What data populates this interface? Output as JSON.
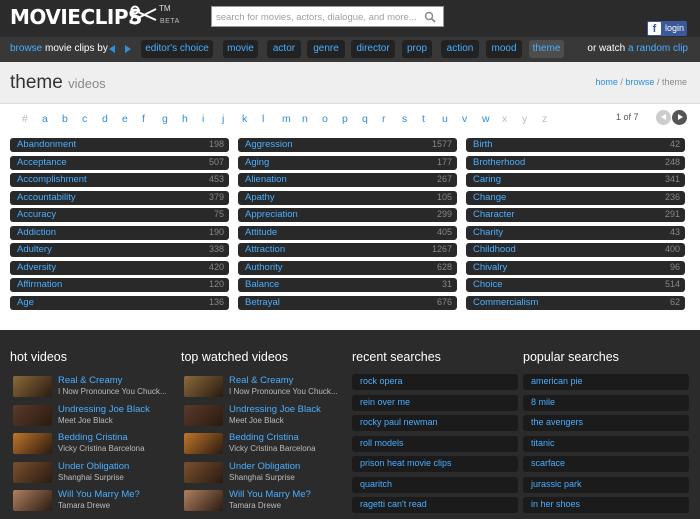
{
  "header": {
    "logo": "MOVIECLIPS",
    "tm": "TM",
    "beta": "BETA",
    "search_placeholder": "search for movies, actors, dialogue, and more...",
    "fb_glyph": "f",
    "login": "login"
  },
  "nav": {
    "browse": "browse",
    "movie_clips_by": "movie clips by",
    "tabs": [
      "editor's choice",
      "movie",
      "actor",
      "genre",
      "director",
      "prop",
      "action",
      "mood",
      "theme"
    ],
    "active_tab": "theme",
    "or_watch": "or watch",
    "random_clip": "a random clip"
  },
  "page": {
    "title": "theme",
    "title_suffix": "videos",
    "crumbs": [
      "home",
      "browse",
      "theme"
    ],
    "crumb_sep": "/"
  },
  "alphabet": [
    "#",
    "a",
    "b",
    "c",
    "d",
    "e",
    "f",
    "g",
    "h",
    "i",
    "j",
    "k",
    "l",
    "m",
    "n",
    "o",
    "p",
    "q",
    "r",
    "s",
    "t",
    "u",
    "v",
    "w",
    "x",
    "y",
    "z"
  ],
  "alphabet_disabled": [
    "#",
    "x",
    "y",
    "z"
  ],
  "pager": {
    "text": "1 of 7"
  },
  "themes": [
    [
      {
        "name": "Abandonment",
        "count": "198"
      },
      {
        "name": "Acceptance",
        "count": "507"
      },
      {
        "name": "Accomplishment",
        "count": "453"
      },
      {
        "name": "Accountability",
        "count": "379"
      },
      {
        "name": "Accuracy",
        "count": "75"
      },
      {
        "name": "Addiction",
        "count": "190"
      },
      {
        "name": "Adultery",
        "count": "338"
      },
      {
        "name": "Adversity",
        "count": "420"
      },
      {
        "name": "Affirmation",
        "count": "120"
      },
      {
        "name": "Age",
        "count": "136"
      }
    ],
    [
      {
        "name": "Aggression",
        "count": "1577"
      },
      {
        "name": "Aging",
        "count": "177"
      },
      {
        "name": "Alienation",
        "count": "267"
      },
      {
        "name": "Apathy",
        "count": "105"
      },
      {
        "name": "Appreciation",
        "count": "299"
      },
      {
        "name": "Attitude",
        "count": "405"
      },
      {
        "name": "Attraction",
        "count": "1267"
      },
      {
        "name": "Authority",
        "count": "628"
      },
      {
        "name": "Balance",
        "count": "31"
      },
      {
        "name": "Betrayal",
        "count": "676"
      }
    ],
    [
      {
        "name": "Birth",
        "count": "42"
      },
      {
        "name": "Brotherhood",
        "count": "248"
      },
      {
        "name": "Caring",
        "count": "341"
      },
      {
        "name": "Change",
        "count": "236"
      },
      {
        "name": "Character",
        "count": "291"
      },
      {
        "name": "Charity",
        "count": "43"
      },
      {
        "name": "Childhood",
        "count": "400"
      },
      {
        "name": "Chivalry",
        "count": "96"
      },
      {
        "name": "Choice",
        "count": "514"
      },
      {
        "name": "Commercialism",
        "count": "62"
      }
    ]
  ],
  "hot_videos": {
    "heading": "hot videos",
    "items": [
      {
        "title": "Real & Creamy",
        "sub": "I Now Pronounce You Chuck...",
        "thumb": "#8a6a3a"
      },
      {
        "title": "Undressing Joe Black",
        "sub": "Meet Joe Black",
        "thumb": "#5a3a2a"
      },
      {
        "title": "Bedding Cristina",
        "sub": "Vicky Cristina Barcelona",
        "thumb": "#c0762a"
      },
      {
        "title": "Under Obligation",
        "sub": "Shanghai Surprise",
        "thumb": "#7a5030"
      },
      {
        "title": "Will You Marry Me?",
        "sub": "Tamara Drewe",
        "thumb": "#b08060"
      }
    ]
  },
  "top_watched": {
    "heading": "top watched videos",
    "items": [
      {
        "title": "Real & Creamy",
        "sub": "I Now Pronounce You Chuck...",
        "thumb": "#8a6a3a"
      },
      {
        "title": "Undressing Joe Black",
        "sub": "Meet Joe Black",
        "thumb": "#5a3a2a"
      },
      {
        "title": "Bedding Cristina",
        "sub": "Vicky Cristina Barcelona",
        "thumb": "#c0762a"
      },
      {
        "title": "Under Obligation",
        "sub": "Shanghai Surprise",
        "thumb": "#7a5030"
      },
      {
        "title": "Will You Marry Me?",
        "sub": "Tamara Drewe",
        "thumb": "#b08060"
      }
    ]
  },
  "recent_searches": {
    "heading": "recent searches",
    "items": [
      "rock opera",
      "rein over me",
      "rocky paul newman",
      "roll models",
      "prison heat movie clips",
      "quaritch",
      "ragetti can't read"
    ]
  },
  "popular_searches": {
    "heading": "popular searches",
    "items": [
      "american pie",
      "8 mile",
      "the avengers",
      "titanic",
      "scarface",
      "jurassic park",
      "in her shoes"
    ]
  },
  "colors": {
    "accent": "#4aaeff",
    "dark_bg": "#2b2b2b",
    "nav_bg": "#383838",
    "facebook": "#3b5998"
  }
}
